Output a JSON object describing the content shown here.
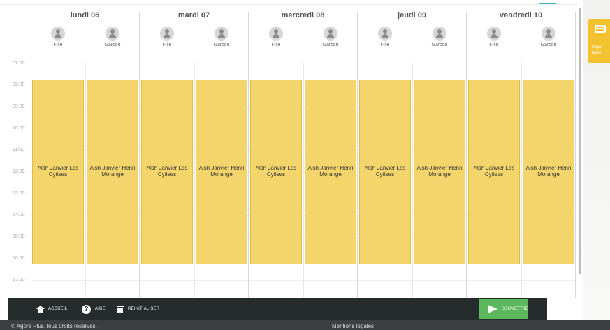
{
  "days": [
    {
      "label": "lundi 06",
      "children": [
        "Fille",
        "Garcon"
      ],
      "bookings": [
        "Alsh Janvier Les Cytises",
        "Alsh Janvier Henri Morange"
      ]
    },
    {
      "label": "mardi 07",
      "children": [
        "Fille",
        "Garcon"
      ],
      "bookings": [
        "Alsh Janvier Les Cytises",
        "Alsh Janvier Henri Morange"
      ]
    },
    {
      "label": "mercredi 08",
      "children": [
        "Fille",
        "Garcon"
      ],
      "bookings": [
        "Alsh Janvier Les Cytises",
        "Alsh Janvier Henri Morange"
      ]
    },
    {
      "label": "jeudi 09",
      "children": [
        "Fille",
        "Garcon"
      ],
      "bookings": [
        "Alsh Janvier Les Cytises",
        "Alsh Janvier Henri Morange"
      ]
    },
    {
      "label": "vendredi 10",
      "children": [
        "Fille",
        "Garcon"
      ],
      "bookings": [
        "Alsh Janvier Les Cytises",
        "Alsh Janvier Henri Morange"
      ]
    }
  ],
  "hours": [
    "07:00",
    "08:00",
    "09:00",
    "10:00",
    "11:00",
    "12:00",
    "13:00",
    "14:00",
    "15:00",
    "16:00",
    "17:00"
  ],
  "side_panel": {
    "pay_label_line1": "Payer",
    "pay_label_line2": "factu",
    "pay_icon": "credit-card-icon"
  },
  "toolbar": {
    "home_label": "ACCUEIL",
    "help_label": "AIDE",
    "reset_label": "RÉINITIALISER",
    "submit_label": "SOUMETTRE",
    "icons": {
      "home": "home-icon",
      "help": "help-icon",
      "reset": "trash-icon",
      "submit": "send-icon"
    }
  },
  "footer": {
    "copyright": "© Agora Plus.Tous droits réservés.",
    "legal": "Mentions légales"
  },
  "colors": {
    "booking": "#f3d56c",
    "toolbar": "#262c2c",
    "submit": "#5cb85c",
    "pay_button": "#f3c22f",
    "accent": "#3fb8c9"
  }
}
